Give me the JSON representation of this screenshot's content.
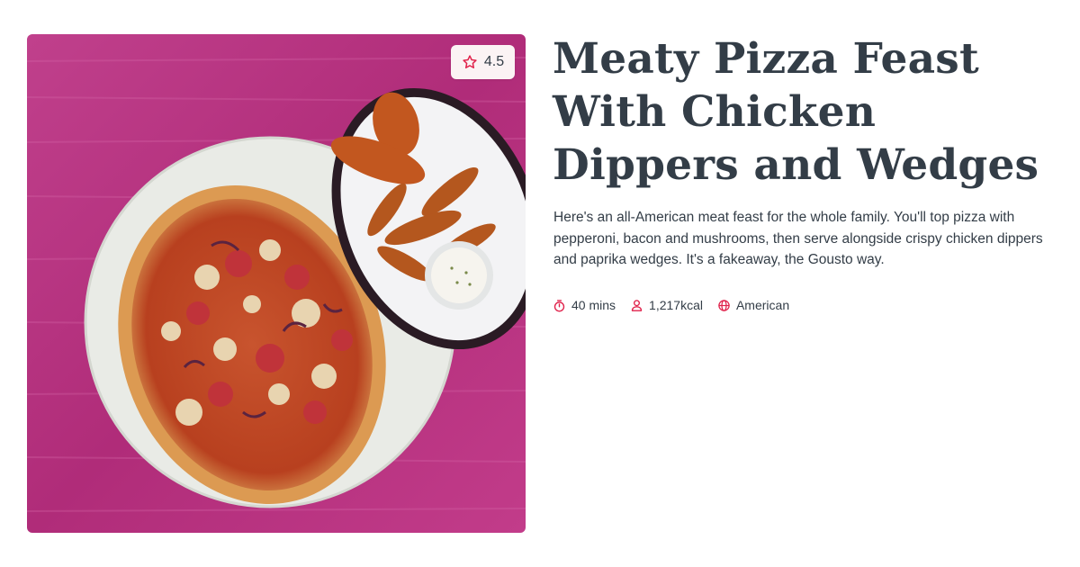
{
  "recipe": {
    "title": "Meaty Pizza Feast With Chicken Dippers and Wedges",
    "description": "Here's an all-American meat feast for the whole family. You'll top pizza with pepperoni, bacon and mushrooms, then serve alongside crispy chicken dippers and paprika wedges. It's a fakeaway, the Gousto way.",
    "rating": "4.5",
    "meta": {
      "time": "40 mins",
      "calories": "1,217kcal",
      "cuisine": "American"
    },
    "icons": {
      "rating": "star-icon",
      "time": "stopwatch-icon",
      "calories": "person-icon",
      "cuisine": "globe-icon"
    }
  },
  "colors": {
    "accent": "#e0224b",
    "text": "#333d47",
    "background_photo": "#b8307c"
  }
}
